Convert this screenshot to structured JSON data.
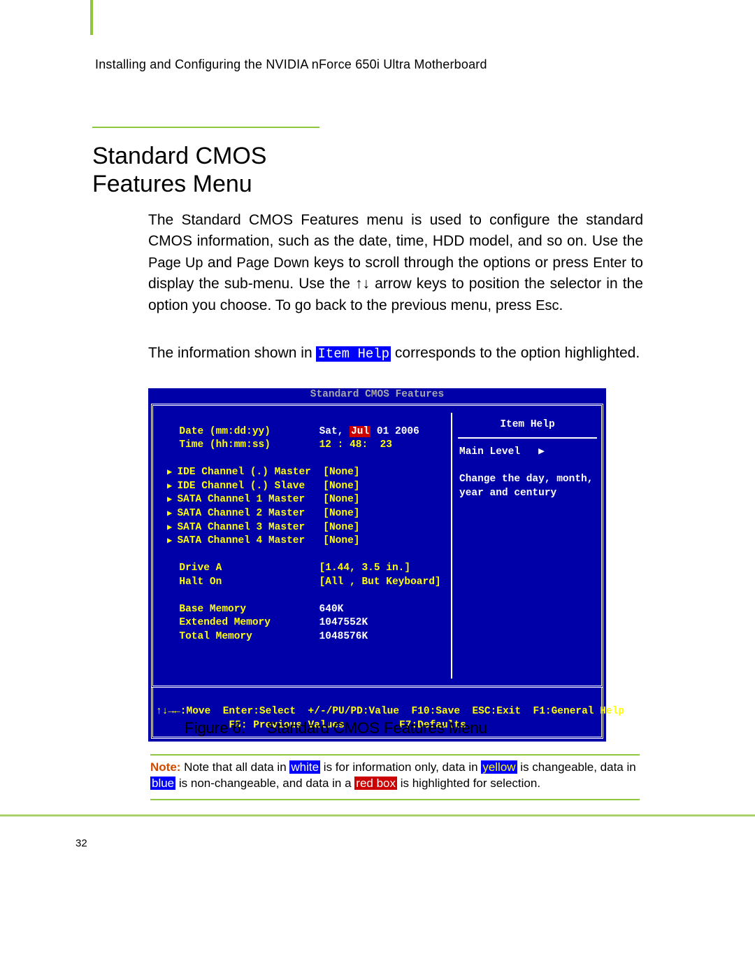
{
  "header": {
    "running_head": "Installing and Configuring the NVIDIA nForce 650i Ultra Motherboard"
  },
  "title": "Standard CMOS Features Menu",
  "paragraph1": {
    "pre1": "The Standard CMOS Features menu is used to configure the standard CMOS information, such as the date, time, HDD model, and so on. Use the ",
    "key1": "Page Up",
    "mid1": " and ",
    "key2": "Page Down",
    "mid2": " keys to scroll through the options or press ",
    "key3": "Enter",
    "mid3": " to display the sub-menu. Use the ",
    "arrows": "↑↓",
    "mid4": " arrow keys to position the selector in the option you choose. To go back to the previous menu, press ",
    "key4": "Esc",
    "end": "."
  },
  "paragraph2": {
    "pre": "The information shown in ",
    "code": "Item Help",
    "post": " corresponds to the option highlighted."
  },
  "bios": {
    "screen_title": "Standard CMOS Features",
    "date_label": "Date (mm:dd:yy)",
    "date_day": "Sat,",
    "date_month": "Jul",
    "date_rest": " 01 2006",
    "time_label": "Time (hh:mm:ss)",
    "time_value": "12 : 48:  23",
    "channels": [
      {
        "label": "IDE Channel (.) Master",
        "value": "[None]"
      },
      {
        "label": "IDE Channel (.) Slave",
        "value": "[None]"
      },
      {
        "label": "SATA Channel 1 Master",
        "value": "[None]"
      },
      {
        "label": "SATA Channel 2 Master",
        "value": "[None]"
      },
      {
        "label": "SATA Channel 3 Master",
        "value": "[None]"
      },
      {
        "label": "SATA Channel 4 Master",
        "value": "[None]"
      }
    ],
    "drive_a_label": "Drive A",
    "drive_a_value": "[1.44, 3.5 in.]",
    "halt_on_label": "Halt On",
    "halt_on_value": "[All , But Keyboard]",
    "base_mem_label": "Base Memory",
    "base_mem_value": "640K",
    "ext_mem_label": "Extended Memory",
    "ext_mem_value": "1047552K",
    "total_mem_label": "Total Memory",
    "total_mem_value": "1048576K",
    "help_title": "Item Help",
    "main_level": "Main Level",
    "help_text": "Change the day, month, year and century",
    "footer_line1": "↑↓→←:Move  Enter:Select  +/-/PU/PD:Value  F10:Save  ESC:Exit  F1:General Help",
    "footer_line2": "            F5: Previous Values         F7:Defaults"
  },
  "figure": {
    "label": "Figure 6.",
    "caption": "Standard CMOS Features Menu"
  },
  "note": {
    "label": "Note:",
    "t1": " Note that all data in ",
    "hl_white": "white",
    "t2": " is for information only, data in ",
    "hl_yellow": "yellow",
    "t3": " is changeable, data in ",
    "hl_blue": "blue",
    "t4": " is non-changeable, and data in a ",
    "hl_red": "red box",
    "t5": " is highlighted for selection."
  },
  "page_number": "32"
}
